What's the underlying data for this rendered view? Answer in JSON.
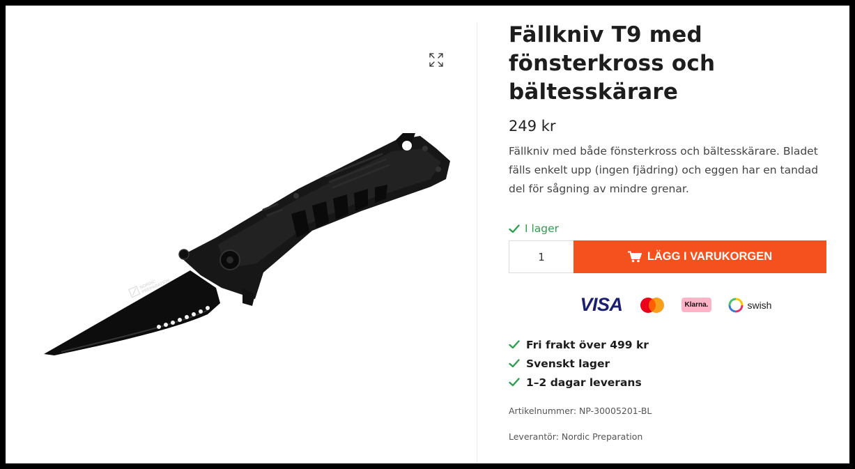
{
  "product": {
    "title": "Fällkniv T9 med fönsterkross och bältesskärare",
    "price": "249 kr",
    "description": "Fällkniv med både fönsterkross och bältesskärare. Bladet fälls enkelt upp (ingen fjädring) och eggen har en tandad del för sågning av mindre grenar.",
    "stock_status": "I lager",
    "quantity_value": "1",
    "add_to_cart_label": "LÄGG I VARUKORGEN",
    "image_icons": {
      "expand": "expand-icon"
    },
    "blade_logo_text": [
      "NORDIC",
      "PREPARATION"
    ]
  },
  "payments": {
    "visa": "VISA",
    "klarna": "Klarna.",
    "swish": "swish",
    "icons": [
      "visa-logo",
      "mastercard-logo",
      "klarna-logo",
      "swish-logo"
    ]
  },
  "usps": [
    {
      "text": "Fri frakt över 499 kr"
    },
    {
      "text": "Svenskt lager"
    },
    {
      "text": "1–2 dagar leverans"
    }
  ],
  "meta": {
    "sku": "Artikelnummer: NP-30005201-BL",
    "vendor": "Leverantör: Nordic Preparation"
  },
  "colors": {
    "accent": "#f4511e",
    "in_stock": "#2e9e4f",
    "check": "#2e9e4f",
    "visa_blue": "#1a1f71",
    "klarna_pink": "#ffb3c7"
  }
}
